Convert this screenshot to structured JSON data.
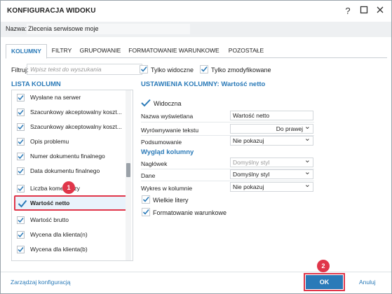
{
  "window": {
    "title": "KONFIGURACJA WIDOKU",
    "help": "?",
    "maximize": "☐",
    "close": "✕"
  },
  "name": {
    "label": "Nazwa:",
    "value": "Zlecenia serwisowe moje"
  },
  "tabs": [
    {
      "label": "KOLUMNY",
      "active": true
    },
    {
      "label": "FILTRY"
    },
    {
      "label": "GRUPOWANIE"
    },
    {
      "label": "FORMATOWANIE WARUNKOWE"
    },
    {
      "label": "POZOSTAŁE"
    }
  ],
  "filter": {
    "label": "Filtruj:",
    "placeholder": "Wpisz tekst do wyszukania",
    "only_visible": "Tylko widoczne",
    "only_modified": "Tylko zmodyfikowane"
  },
  "list": {
    "header": "LISTA KOLUMN",
    "items": [
      {
        "label": "Wysłane na serwer"
      },
      {
        "label": "Szacunkowy akceptowalny koszt..."
      },
      {
        "label": "Szacunkowy akceptowalny koszt..."
      },
      {
        "label": "Opis problemu"
      },
      {
        "label": "Numer dokumentu finalnego"
      },
      {
        "label": "Data dokumentu finalnego"
      },
      {
        "label": "Liczba komentarzy"
      },
      {
        "label": "Wartość netto",
        "selected": true
      },
      {
        "label": "Wartość brutto"
      },
      {
        "label": "Wycena dla klienta(n)"
      },
      {
        "label": "Wycena dla klienta(b)"
      }
    ]
  },
  "settings": {
    "header": "USTAWIENIA KOLUMNY: Wartość netto",
    "visible": "Widoczna",
    "display_name_label": "Nazwa wyświetlana",
    "display_name_value": "Wartość netto",
    "alignment_label": "Wyrównywanie tekstu",
    "alignment_value": "Do prawej",
    "summary_label": "Podsumowanie",
    "summary_value": "Nie pokazuj",
    "appearance_header": "Wygląd kolumny",
    "header_label": "Nagłówek",
    "header_value": "Domyślny styl",
    "data_label": "Dane",
    "data_value": "Domyślny styl",
    "chart_label": "Wykres w kolumnie",
    "chart_value": "Nie pokazuj",
    "uppercase": "Wielkie litery",
    "conditional": "Formatowanie warunkowe"
  },
  "footer": {
    "manage": "Zarządzaj konfiguracją",
    "ok": "OK",
    "cancel": "Anuluj"
  },
  "badges": {
    "one": "1",
    "two": "2"
  },
  "colors": {
    "accent": "#2a7ab8",
    "highlight": "#e0364a"
  }
}
